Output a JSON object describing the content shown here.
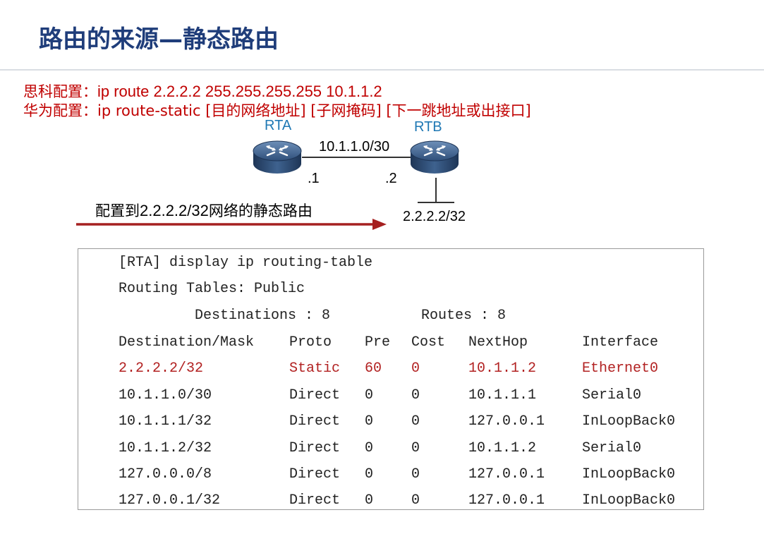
{
  "title": "路由的来源—静态路由",
  "config": {
    "cisco_prefix": "思科配置：",
    "cisco_cmd": "ip route 2.2.2.2 255.255.255.255 10.1.1.2",
    "huawei_prefix": "华为配置：",
    "huawei_cmd": "ip route-static [目的网络地址] [子网掩码] [下一跳地址或出接口]"
  },
  "topology": {
    "rta_label": "RTA",
    "rtb_label": "RTB",
    "link_network": "10.1.1.0/30",
    "rta_if": ".1",
    "rtb_if": ".2",
    "host_network": "2.2.2.2/32",
    "arrow_text_cjk": "配置到",
    "arrow_text_addr": "2.2.2.2/32",
    "arrow_text_tail": "网络的静态路由",
    "colors": {
      "router_label": "#1f78b4",
      "arrow": "#a52020",
      "config_text": "#c00000"
    }
  },
  "terminal": {
    "command": "[RTA] display ip routing-table",
    "tables_line": "Routing Tables: Public",
    "destinations_line": "Destinations : 8",
    "routes_line": "Routes : 8",
    "headers": [
      "Destination/Mask",
      "Proto",
      "Pre",
      "Cost",
      "NextHop",
      "Interface"
    ],
    "rows": [
      [
        "2.2.2.2/32",
        "Static",
        "60",
        "0",
        "10.1.1.2",
        "Ethernet0"
      ],
      [
        "10.1.1.0/30",
        "Direct",
        "0",
        "0",
        "10.1.1.1",
        "Serial0"
      ],
      [
        "10.1.1.1/32",
        "Direct",
        "0",
        "0",
        "127.0.0.1",
        "InLoopBack0"
      ],
      [
        "10.1.1.2/32",
        "Direct",
        "0",
        "0",
        "10.1.1.2",
        "Serial0"
      ],
      [
        "127.0.0.0/8",
        "Direct",
        "0",
        "0",
        "127.0.0.1",
        "InLoopBack0"
      ],
      [
        "127.0.0.1/32",
        "Direct",
        "0",
        "0",
        "127.0.0.1",
        "InLoopBack0"
      ]
    ],
    "highlight_color": "#b22222"
  }
}
